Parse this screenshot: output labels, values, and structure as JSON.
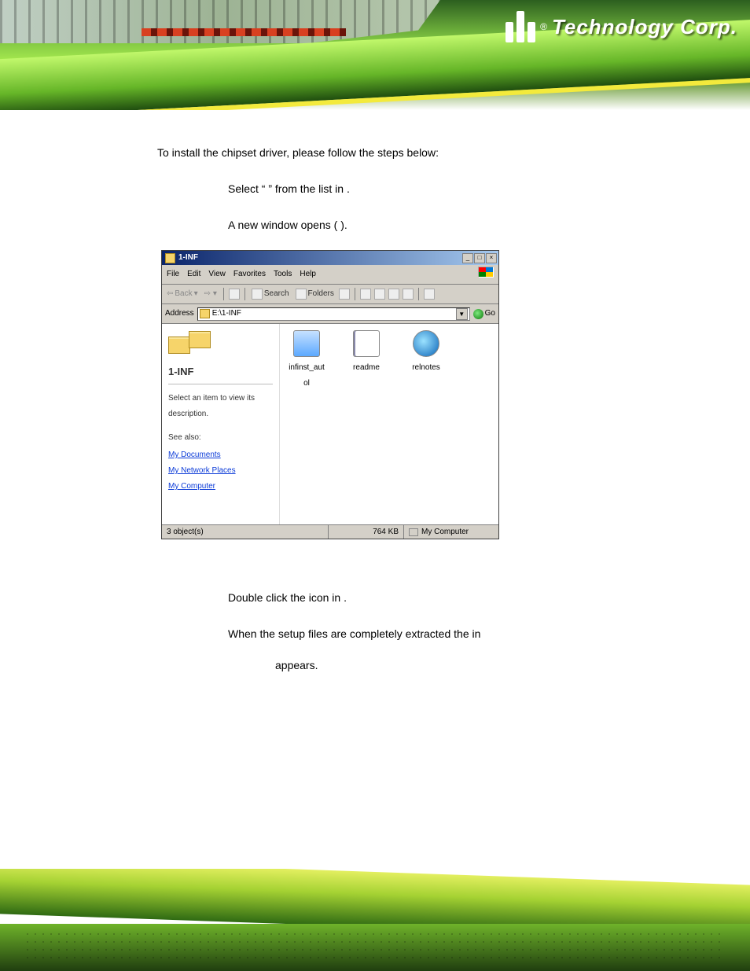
{
  "header": {
    "brand_registered": "®",
    "brand_text": "Technology Corp."
  },
  "intro": "To install the chipset driver, please follow the steps below:",
  "steps": {
    "s1": {
      "pre": "Select “",
      "mid": "” from the list in ",
      "end": "."
    },
    "s2": {
      "pre": "A new window opens (",
      "end": ")."
    },
    "s3": {
      "pre": "Double click the ",
      "mid": " icon in ",
      "end": "."
    },
    "s4": {
      "pre": "When the setup files are completely extracted the ",
      "mid": " in",
      "line2": "appears."
    }
  },
  "explorer": {
    "title": "1-INF",
    "menu": {
      "file": "File",
      "edit": "Edit",
      "view": "View",
      "favorites": "Favorites",
      "tools": "Tools",
      "help": "Help"
    },
    "toolbar": {
      "back": "Back",
      "search": "Search",
      "folders": "Folders"
    },
    "address_label": "Address",
    "address_value": "E:\\1-INF",
    "go_label": "Go",
    "leftpane": {
      "title": "1-INF",
      "description": "Select an item to view its description.",
      "see_also": "See also:",
      "links": {
        "mydocs": "My Documents",
        "mynet": "My Network Places",
        "mycomp": "My Computer"
      }
    },
    "files": [
      {
        "name": "infinst_autol",
        "type": "exe"
      },
      {
        "name": "readme",
        "type": "txt"
      },
      {
        "name": "relnotes",
        "type": "html"
      }
    ],
    "status": {
      "objects": "3 object(s)",
      "size": "764 KB",
      "location": "My Computer"
    }
  }
}
